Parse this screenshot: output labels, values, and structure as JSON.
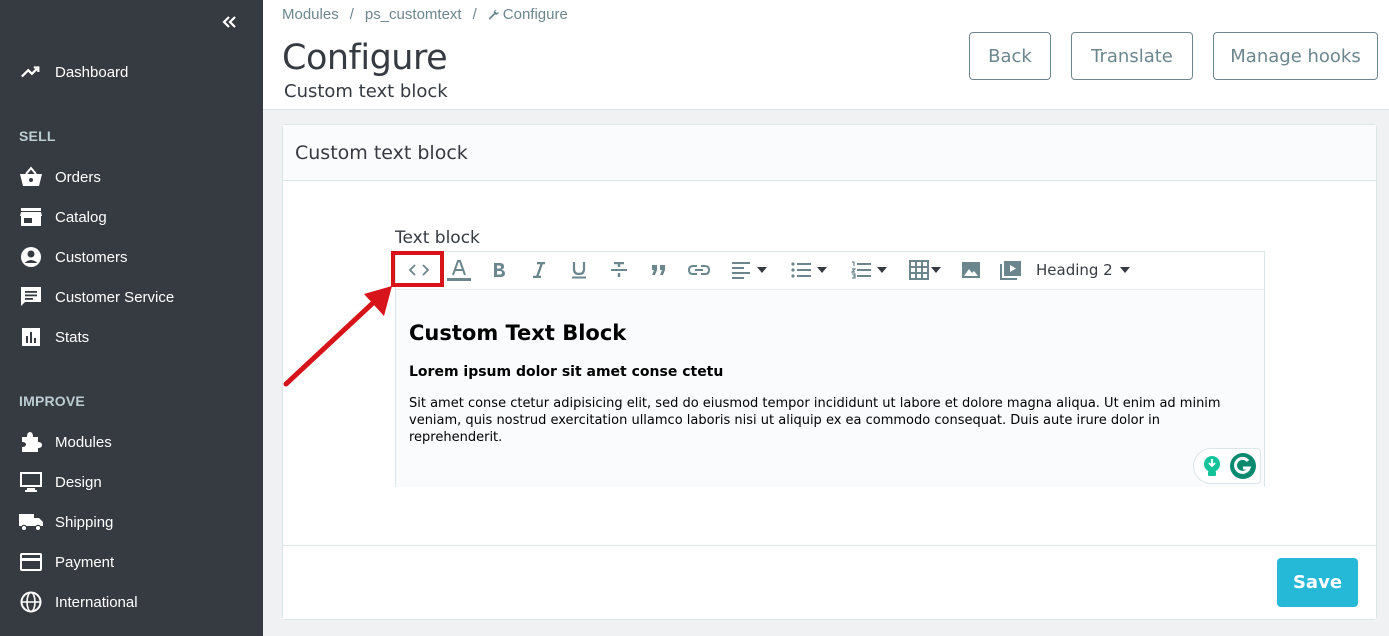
{
  "sidebar": {
    "items": [
      {
        "label": "Dashboard",
        "icon": "trending-up-icon"
      },
      {
        "label": "Orders",
        "icon": "basket-icon"
      },
      {
        "label": "Catalog",
        "icon": "store-icon"
      },
      {
        "label": "Customers",
        "icon": "account-circle-icon"
      },
      {
        "label": "Customer Service",
        "icon": "chat-icon"
      },
      {
        "label": "Stats",
        "icon": "bar-chart-icon"
      },
      {
        "label": "Modules",
        "icon": "puzzle-icon"
      },
      {
        "label": "Design",
        "icon": "desktop-icon"
      },
      {
        "label": "Shipping",
        "icon": "truck-icon"
      },
      {
        "label": "Payment",
        "icon": "credit-card-icon"
      },
      {
        "label": "International",
        "icon": "globe-icon"
      }
    ],
    "sections": {
      "sell": "SELL",
      "improve": "IMPROVE"
    }
  },
  "breadcrumb": {
    "items": [
      "Modules",
      "ps_customtext",
      "Configure"
    ],
    "separator": "/"
  },
  "header": {
    "title": "Configure",
    "subtitle": "Custom text block",
    "buttons": {
      "back": "Back",
      "translate": "Translate",
      "manage_hooks": "Manage hooks"
    }
  },
  "card": {
    "title": "Custom text block",
    "field_label": "Text block",
    "toolbar": {
      "block_format": "Heading 2"
    },
    "content": {
      "heading": "Custom Text Block",
      "subheading": "Lorem ipsum dolor sit amet conse ctetu",
      "paragraph": "Sit amet conse ctetur adipisicing elit, sed do eiusmod tempor incididunt ut labore et dolore magna aliqua. Ut enim ad minim veniam, quis nostrud exercitation ullamco laboris nisi ut aliquip ex ea commodo consequat. Duis aute irure dolor in reprehenderit."
    },
    "save_label": "Save"
  },
  "colors": {
    "sidebar_bg": "#363a41",
    "accent": "#25b9d7",
    "highlight": "#d7141a"
  }
}
